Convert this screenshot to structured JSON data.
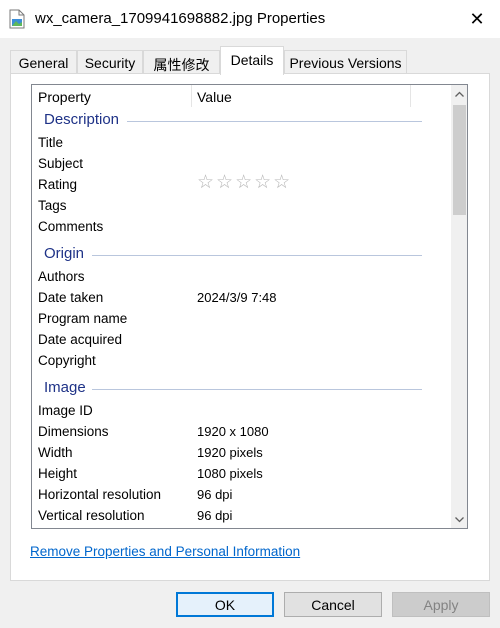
{
  "window": {
    "title": "wx_camera_1709941698882.jpg Properties"
  },
  "tabs": [
    {
      "label": "General"
    },
    {
      "label": "Security"
    },
    {
      "label": "属性修改"
    },
    {
      "label": "Details"
    },
    {
      "label": "Previous Versions"
    }
  ],
  "active_tab": "Details",
  "list": {
    "headers": {
      "property": "Property",
      "value": "Value"
    },
    "groups": {
      "description": {
        "title": "Description",
        "rows": [
          {
            "label": "Title",
            "value": ""
          },
          {
            "label": "Subject",
            "value": ""
          },
          {
            "label": "Rating",
            "value": ""
          },
          {
            "label": "Tags",
            "value": ""
          },
          {
            "label": "Comments",
            "value": ""
          }
        ]
      },
      "origin": {
        "title": "Origin",
        "rows": [
          {
            "label": "Authors",
            "value": ""
          },
          {
            "label": "Date taken",
            "value": "2024/3/9 7:48"
          },
          {
            "label": "Program name",
            "value": ""
          },
          {
            "label": "Date acquired",
            "value": ""
          },
          {
            "label": "Copyright",
            "value": ""
          }
        ]
      },
      "image": {
        "title": "Image",
        "rows": [
          {
            "label": "Image ID",
            "value": ""
          },
          {
            "label": "Dimensions",
            "value": "1920 x 1080"
          },
          {
            "label": "Width",
            "value": "1920 pixels"
          },
          {
            "label": "Height",
            "value": "1080 pixels"
          },
          {
            "label": "Horizontal resolution",
            "value": "96 dpi"
          },
          {
            "label": "Vertical resolution",
            "value": "96 dpi"
          }
        ]
      }
    },
    "rating_stars": {
      "glyphs": "☆☆☆☆☆",
      "filled": 0,
      "total": 5
    }
  },
  "remove_link": "Remove Properties and Personal Information",
  "buttons": {
    "ok": "OK",
    "cancel": "Cancel",
    "apply": "Apply"
  },
  "colors": {
    "accent": "#0078d7",
    "group_heading": "#1e3287",
    "link": "#0066cc"
  }
}
